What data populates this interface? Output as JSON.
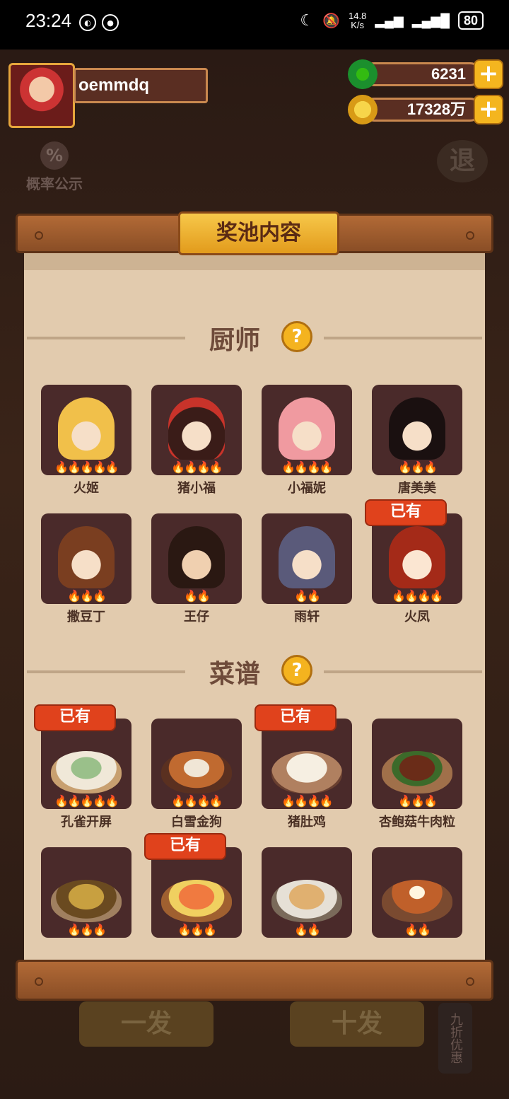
{
  "status": {
    "time": "23:24",
    "net_speed_top": "14.8",
    "net_speed_unit": "K/s",
    "battery": "80"
  },
  "player": {
    "name": "oemmdq",
    "jade": "6231",
    "coins": "17328万",
    "plus_symbol": "+"
  },
  "top_actions": {
    "probability_label": "概率公示",
    "probability_icon": "%",
    "exit_label": "退"
  },
  "panel": {
    "title": "奖池内容",
    "owned_label": "已有",
    "help_symbol": "?"
  },
  "chefs": {
    "section_title": "厨师",
    "items": [
      {
        "name": "火姬",
        "flames": "🔥🔥🔥🔥🔥",
        "owned": false
      },
      {
        "name": "猪小福",
        "flames": "🔥🔥🔥🔥",
        "owned": false
      },
      {
        "name": "小福妮",
        "flames": "🔥🔥🔥🔥",
        "owned": false
      },
      {
        "name": "唐美美",
        "flames": "🔥🔥🔥",
        "owned": false
      },
      {
        "name": "撒豆丁",
        "flames": "🔥🔥🔥",
        "owned": false
      },
      {
        "name": "王仔",
        "flames": "🔥🔥",
        "owned": false
      },
      {
        "name": "雨轩",
        "flames": "🔥🔥",
        "owned": false
      },
      {
        "name": "火凤",
        "flames": "🔥🔥🔥🔥",
        "owned": true
      }
    ]
  },
  "recipes": {
    "section_title": "菜谱",
    "items": [
      {
        "name": "孔雀开屏",
        "flames": "🔥🔥🔥🔥🔥",
        "owned": true
      },
      {
        "name": "白雪金狗",
        "flames": "🔥🔥🔥🔥",
        "owned": false
      },
      {
        "name": "猪肚鸡",
        "flames": "🔥🔥🔥🔥",
        "owned": true
      },
      {
        "name": "杏鲍菇牛肉粒",
        "flames": "🔥🔥🔥",
        "owned": false
      },
      {
        "name": "",
        "flames": "🔥🔥🔥",
        "owned": false
      },
      {
        "name": "",
        "flames": "🔥🔥🔥",
        "owned": true
      },
      {
        "name": "",
        "flames": "🔥🔥",
        "owned": false
      },
      {
        "name": "",
        "flames": "🔥🔥",
        "owned": false
      }
    ]
  },
  "bottom": {
    "single_draw": "一发",
    "ten_draw": "十发",
    "discount_tag": "九折优惠"
  }
}
